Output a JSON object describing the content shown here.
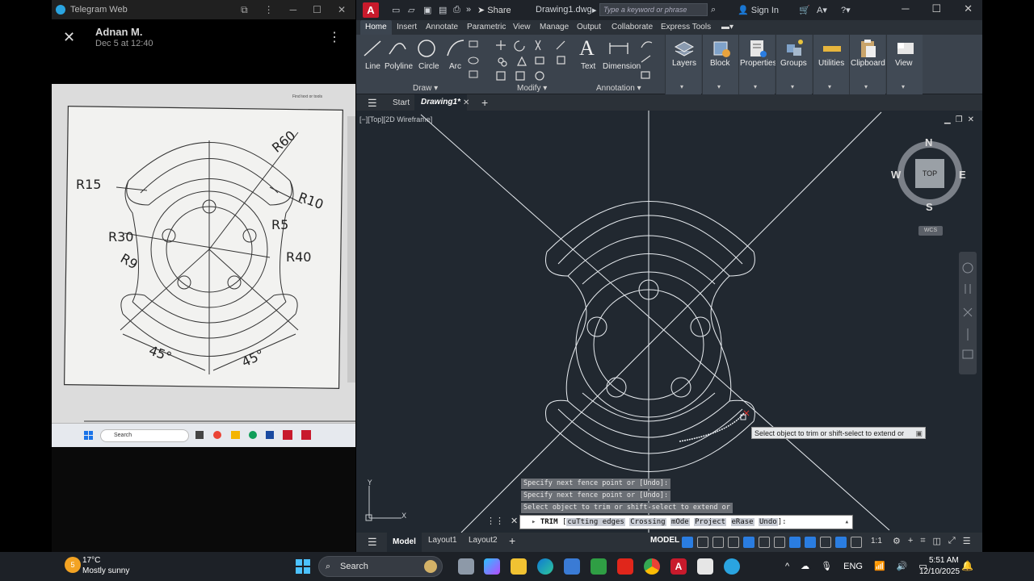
{
  "telegram": {
    "window_title": "Telegram Web",
    "sender_name": "Adnan M.",
    "sent_date": "Dec 5 at 12:40",
    "photo": {
      "find_text": "Find text or tools",
      "dimension_labels": [
        "R60",
        "R15",
        "R10",
        "R5",
        "R30",
        "R40",
        "R9",
        "45°",
        "45°"
      ],
      "taskbar_search": "Search"
    }
  },
  "autocad": {
    "app_letter": "A",
    "share_label": "Share",
    "doc_title": "Drawing1.dwg",
    "search_placeholder": "Type a keyword or phrase",
    "sign_in": "Sign In",
    "ribbon_tabs": [
      "Home",
      "Insert",
      "Annotate",
      "Parametric",
      "View",
      "Manage",
      "Output",
      "Collaborate",
      "Express Tools"
    ],
    "active_tab": "Home",
    "draw_tools": [
      "Line",
      "Polyline",
      "Circle",
      "Arc"
    ],
    "annotation_tools": [
      "Text",
      "Dimension"
    ],
    "big_tools": [
      "Layers",
      "Block",
      "Properties",
      "Groups",
      "Utilities",
      "Clipboard",
      "View"
    ],
    "panels": [
      "Draw",
      "Modify",
      "Annotation"
    ],
    "file_tabs": {
      "start": "Start",
      "drawing": "Drawing1*"
    },
    "viewport_label": "[−][Top][2D Wireframe]",
    "viewcube": {
      "n": "N",
      "s": "S",
      "e": "E",
      "w": "W",
      "face": "TOP",
      "wcs": "WCS"
    },
    "tooltip": "Select object to trim or shift-select to extend or",
    "command_history": [
      "Specify next fence point or [Undo]:",
      "Specify next fence point or [Undo]:",
      "Select object to trim or shift-select to extend or"
    ],
    "command_line": {
      "command": "TRIM",
      "options": [
        "cuTting edges",
        "Crossing",
        "mOde",
        "Project",
        "eRase",
        "Undo"
      ],
      "suffix": "]:"
    },
    "layout_tabs": [
      "Model",
      "Layout1",
      "Layout2"
    ],
    "status_model": "MODEL",
    "scale": "1:1",
    "colors": {
      "bg": "#212830",
      "ribbon": "#3b434d",
      "accent_red": "#c81a2c",
      "line_white": "#e8ecf0"
    }
  },
  "taskbar": {
    "weather_badge": "5",
    "weather_temp": "17°C",
    "weather_desc": "Mostly sunny",
    "search_label": "Search",
    "language": "ENG",
    "time": "5:51 AM",
    "date": "12/10/2025"
  }
}
